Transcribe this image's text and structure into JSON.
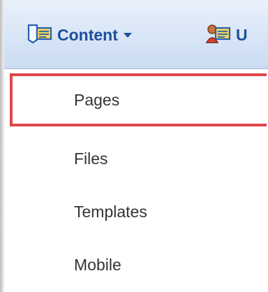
{
  "menubar": {
    "content_label": "Content",
    "users_label": "U"
  },
  "dropdown": {
    "items": [
      {
        "label": "Pages",
        "selected": true
      },
      {
        "label": "Files",
        "selected": false
      },
      {
        "label": "Templates",
        "selected": false
      },
      {
        "label": "Mobile",
        "selected": false
      }
    ]
  },
  "colors": {
    "menu_text": "#1f4e9c",
    "selection_border": "#e0464a"
  }
}
